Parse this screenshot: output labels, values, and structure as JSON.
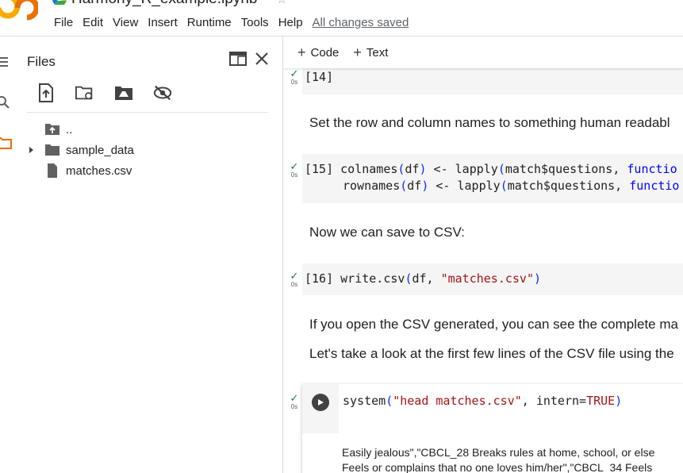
{
  "header": {
    "notebook_title": "Harmony_R_example.ipynb",
    "menu": [
      "File",
      "Edit",
      "View",
      "Insert",
      "Runtime",
      "Tools",
      "Help"
    ],
    "save_status": "All changes saved"
  },
  "files_panel": {
    "title": "Files",
    "tree": [
      {
        "label": "..",
        "type": "parent"
      },
      {
        "label": "sample_data",
        "type": "folder"
      },
      {
        "label": "matches.csv",
        "type": "file"
      }
    ]
  },
  "notebook_toolbar": {
    "add_code": "Code",
    "add_text": "Text"
  },
  "cells": {
    "c14": {
      "prompt": "[14]",
      "time": "0s"
    },
    "t1": {
      "text": "Set the row and column names to something human readabl"
    },
    "c15": {
      "prompt": "[15]",
      "time": "0s",
      "line1_fn": "colnames",
      "line1_arg": "df",
      "line1_mid": " <- lapply",
      "line1_rest": "match$questions, ",
      "line1_kw": "functio",
      "line2_fn": "rownames",
      "line2_arg": "df",
      "line2_mid": " <- lapply",
      "line2_rest": "match$questions, ",
      "line2_kw": "functio"
    },
    "t2": {
      "text": "Now we can save to CSV:"
    },
    "c16": {
      "prompt": "[16]",
      "time": "0s",
      "fn": "write.csv",
      "arg": "df, ",
      "str": "\"matches.csv\""
    },
    "t3": {
      "text": "If you open the CSV generated, you can see the complete ma"
    },
    "t4": {
      "text": "Let's take a look at the first few lines of the CSV file using the"
    },
    "c17": {
      "time": "0s",
      "fn": "system",
      "str": "\"head matches.csv\"",
      "rest": ", intern=",
      "const": "TRUE"
    },
    "output": {
      "line1": "Easily jealous\",\"CBCL_28 Breaks rules at home, school, or else",
      "line2": "Feels or complains that no one loves him/her\",\"CBCL_34 Feels"
    }
  },
  "colors": {
    "accent_orange": "#f9ab00",
    "check_green": "#188038"
  }
}
